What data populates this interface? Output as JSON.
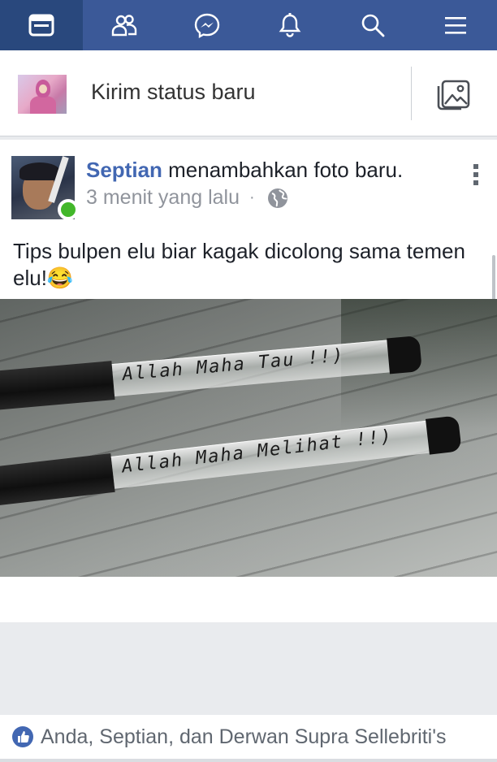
{
  "nav": {
    "items": [
      {
        "name": "news-feed",
        "icon": "news-feed-icon",
        "active": true
      },
      {
        "name": "friend-requests",
        "icon": "friends-icon",
        "active": false
      },
      {
        "name": "messenger",
        "icon": "messenger-icon",
        "active": false
      },
      {
        "name": "notifications",
        "icon": "bell-icon",
        "active": false
      },
      {
        "name": "search",
        "icon": "search-icon",
        "active": false
      },
      {
        "name": "menu",
        "icon": "hamburger-icon",
        "active": false
      }
    ],
    "colors": {
      "bar": "#3b5998",
      "active": "#29487d"
    }
  },
  "composer": {
    "placeholder": "Kirim status baru",
    "photo_icon": "photo-icon"
  },
  "post": {
    "author": "Septian",
    "action": " menambahkan foto baru.",
    "time": "3 menit yang lalu",
    "separator": "·",
    "privacy_icon": "globe-icon",
    "caption": "Tips bulpen elu biar kagak dicolong sama temen elu!😂",
    "photo": {
      "pens": [
        {
          "text": "Allah  Maha  Tau !!)"
        },
        {
          "text": "Allah  Maha  Melihat !!)"
        }
      ]
    },
    "reactions": {
      "icon": "like-icon",
      "names": "Anda, Septian, dan Derwan Supra Sellebriti's"
    },
    "online": true
  }
}
